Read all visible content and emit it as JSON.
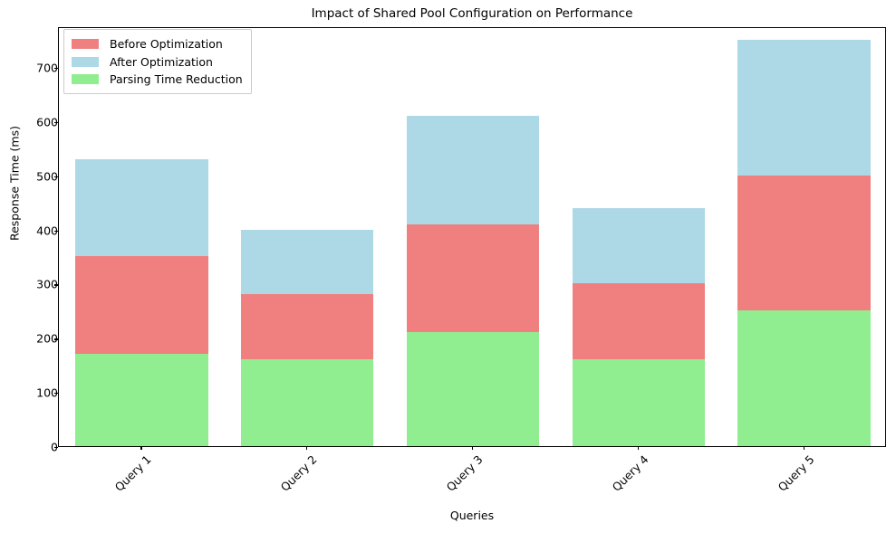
{
  "chart_data": {
    "type": "bar",
    "bar_mode": "overlapping",
    "title": "Impact of Shared Pool Configuration on Performance",
    "xlabel": "Queries",
    "ylabel": "Response Time (ms)",
    "categories": [
      "Query 1",
      "Query 2",
      "Query 3",
      "Query 4",
      "Query 5"
    ],
    "series": [
      {
        "name": "Before Optimization",
        "color": "#F08080",
        "values": [
          350,
          280,
          410,
          300,
          500
        ]
      },
      {
        "name": "After Optimization",
        "color": "#ADD8E6",
        "values": [
          530,
          400,
          610,
          440,
          750
        ]
      },
      {
        "name": "Parsing Time Reduction",
        "color": "#90EE90",
        "values": [
          170,
          160,
          210,
          160,
          250
        ]
      }
    ],
    "draw_order": [
      "After Optimization",
      "Before Optimization",
      "Parsing Time Reduction"
    ],
    "ylim": [
      0,
      775
    ],
    "yticks": [
      0,
      100,
      200,
      300,
      400,
      500,
      600,
      700
    ],
    "ytick_labels": [
      "0",
      "100",
      "200",
      "300",
      "400",
      "500",
      "600",
      "700"
    ],
    "grid": false,
    "legend_position": "upper left",
    "xtick_rotation": -45
  }
}
